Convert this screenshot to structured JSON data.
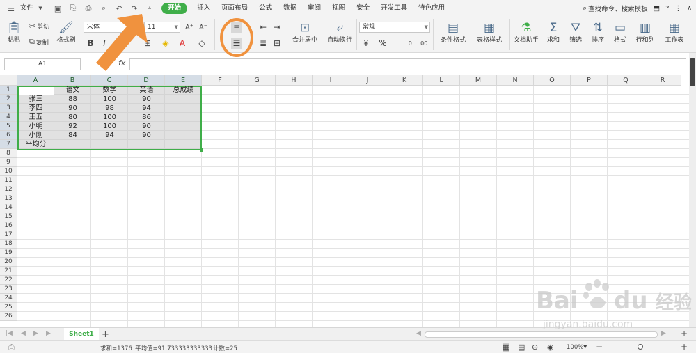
{
  "menubar": {
    "file_label": "文件",
    "tabs": [
      {
        "label": "开始",
        "active": true
      },
      {
        "label": "插入"
      },
      {
        "label": "页面布局"
      },
      {
        "label": "公式"
      },
      {
        "label": "数据"
      },
      {
        "label": "审阅"
      },
      {
        "label": "视图"
      },
      {
        "label": "安全"
      },
      {
        "label": "开发工具"
      },
      {
        "label": "特色应用"
      }
    ],
    "search_label": "查找命令、搜索模板"
  },
  "ribbon": {
    "paste": "粘贴",
    "cut": "剪切",
    "copy": "复制",
    "format_painter": "格式刷",
    "font_name": "宋体",
    "font_size": "11",
    "bold": "B",
    "italic": "I",
    "merge_center": "合并居中",
    "wrap_text": "自动换行",
    "number_format": "常规",
    "percent": "%",
    "conditional_format": "条件格式",
    "table_style": "表格样式",
    "doc_helper": "文档助手",
    "sum": "求和",
    "filter": "筛选",
    "sort": "排序",
    "format": "格式",
    "rows_cols": "行和列",
    "worksheet": "工作表"
  },
  "formula_bar": {
    "cell_ref": "A1",
    "fx": "fx"
  },
  "columns": [
    "A",
    "B",
    "C",
    "D",
    "E",
    "F",
    "G",
    "H",
    "I",
    "J",
    "K",
    "L",
    "M",
    "N",
    "O",
    "P",
    "Q",
    "R"
  ],
  "rows": [
    "1",
    "2",
    "3",
    "4",
    "5",
    "6",
    "7",
    "8",
    "9",
    "10",
    "11",
    "12",
    "13",
    "14",
    "15",
    "16",
    "17",
    "18",
    "19",
    "20",
    "21",
    "22",
    "23",
    "24",
    "25",
    "26"
  ],
  "sheet_data": {
    "headers": [
      "",
      "语文",
      "数学",
      "英语",
      "总成绩"
    ],
    "records": [
      [
        "张三",
        "88",
        "100",
        "90",
        ""
      ],
      [
        "李四",
        "90",
        "98",
        "94",
        ""
      ],
      [
        "王五",
        "80",
        "100",
        "86",
        ""
      ],
      [
        "小明",
        "92",
        "100",
        "90",
        ""
      ],
      [
        "小刚",
        "84",
        "94",
        "90",
        ""
      ],
      [
        "平均分",
        "",
        "",
        "",
        ""
      ]
    ]
  },
  "sheet_tabs": {
    "active": "Sheet1",
    "add": "+"
  },
  "statusbar": {
    "sum": "求和=1376",
    "average": "平均值=91.733333333333",
    "count": "计数=25",
    "zoom": "100%",
    "zoom_fraction": 0.5
  },
  "watermark": {
    "brand": "Bai",
    "brand2": "du",
    "brand_cn": "经验",
    "url": "jingyan.baidu.com"
  },
  "colors": {
    "accent": "#3fae49",
    "annotation": "#f0923e"
  }
}
